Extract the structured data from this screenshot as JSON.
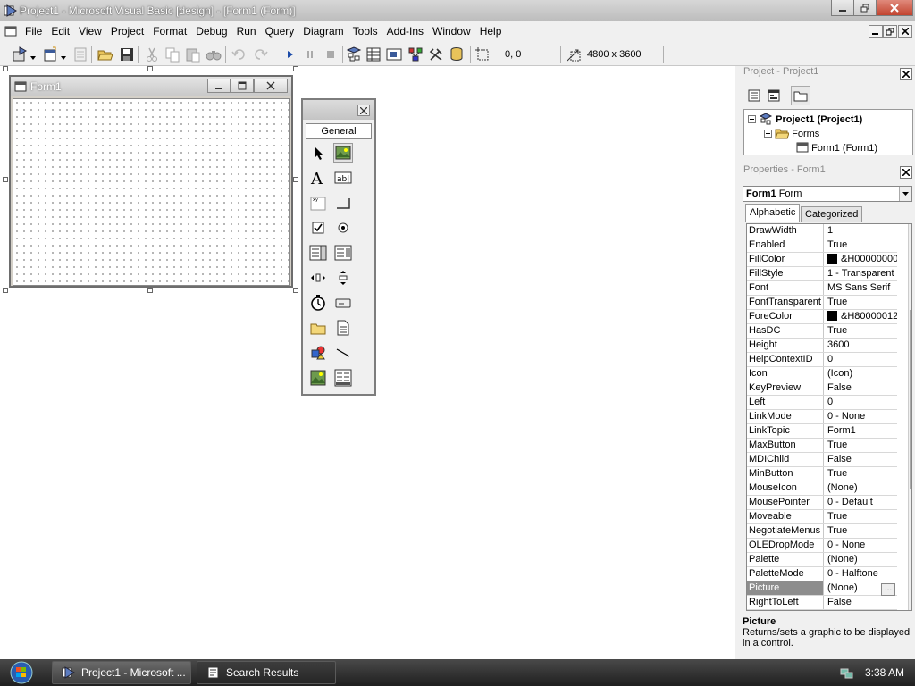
{
  "window": {
    "title": "Project1 - Microsoft Visual Basic [design] - [Form1 (Form)]"
  },
  "menu": {
    "items": [
      "File",
      "Edit",
      "View",
      "Project",
      "Format",
      "Debug",
      "Run",
      "Query",
      "Diagram",
      "Tools",
      "Add-Ins",
      "Window",
      "Help"
    ]
  },
  "toolbar": {
    "position": "0, 0",
    "size": "4800 x 3600"
  },
  "form": {
    "caption": "Form1"
  },
  "toolbox": {
    "tab": "General"
  },
  "project": {
    "title": "Project - Project1",
    "root": "Project1 (Project1)",
    "folder": "Forms",
    "item": "Form1 (Form1)"
  },
  "properties": {
    "title": "Properties - Form1",
    "object_name": "Form1",
    "object_type": "Form",
    "tab_alphabetic": "Alphabetic",
    "tab_categorized": "Categorized",
    "ellipsis": "...",
    "rows": [
      {
        "name": "DrawWidth",
        "value": "1"
      },
      {
        "name": "Enabled",
        "value": "True"
      },
      {
        "name": "FillColor",
        "value": "&H00000000",
        "color": "#000000"
      },
      {
        "name": "FillStyle",
        "value": "1 - Transparent"
      },
      {
        "name": "Font",
        "value": "MS Sans Serif"
      },
      {
        "name": "FontTransparent",
        "value": "True"
      },
      {
        "name": "ForeColor",
        "value": "&H80000012",
        "color": "#000000"
      },
      {
        "name": "HasDC",
        "value": "True"
      },
      {
        "name": "Height",
        "value": "3600"
      },
      {
        "name": "HelpContextID",
        "value": "0"
      },
      {
        "name": "Icon",
        "value": "(Icon)"
      },
      {
        "name": "KeyPreview",
        "value": "False"
      },
      {
        "name": "Left",
        "value": "0"
      },
      {
        "name": "LinkMode",
        "value": "0 - None"
      },
      {
        "name": "LinkTopic",
        "value": "Form1"
      },
      {
        "name": "MaxButton",
        "value": "True"
      },
      {
        "name": "MDIChild",
        "value": "False"
      },
      {
        "name": "MinButton",
        "value": "True"
      },
      {
        "name": "MouseIcon",
        "value": "(None)"
      },
      {
        "name": "MousePointer",
        "value": "0 - Default"
      },
      {
        "name": "Moveable",
        "value": "True"
      },
      {
        "name": "NegotiateMenus",
        "value": "True"
      },
      {
        "name": "OLEDropMode",
        "value": "0 - None"
      },
      {
        "name": "Palette",
        "value": "(None)"
      },
      {
        "name": "PaletteMode",
        "value": "0 - Halftone"
      },
      {
        "name": "Picture",
        "value": "(None)",
        "selected": true
      },
      {
        "name": "RightToLeft",
        "value": "False"
      }
    ],
    "desc_title": "Picture",
    "desc_text": "Returns/sets a graphic to be displayed in a control."
  },
  "taskbar": {
    "items": [
      "Project1 - Microsoft ...",
      "Search Results"
    ],
    "clock": "3:38 AM"
  },
  "colors": {
    "selected_row": "#8d8d8d",
    "swatch": "#000000"
  }
}
